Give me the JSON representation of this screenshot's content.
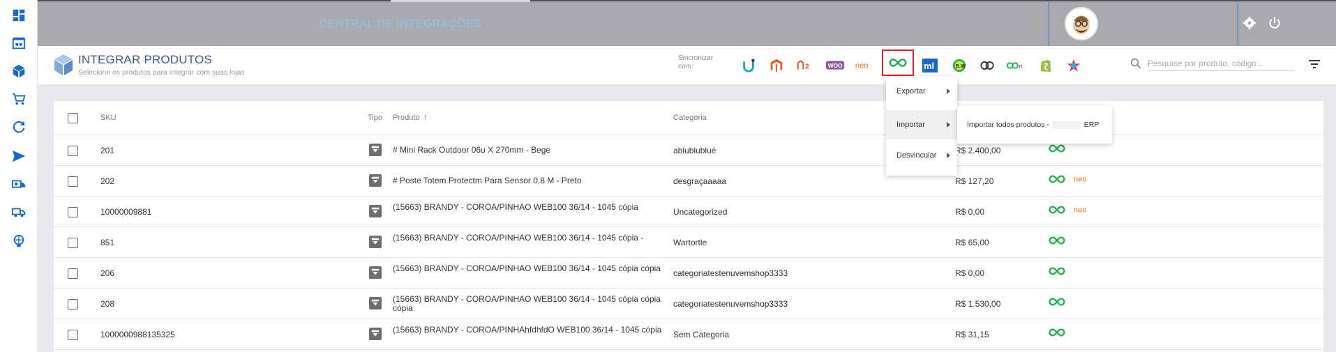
{
  "header": {
    "title": "CENTRAL DE INTEGRAÇÕES"
  },
  "page": {
    "title": "INTEGRAR PRODUTOS",
    "subtitle": "Selecione os produtos para integrar com suas lojas"
  },
  "sync": {
    "label": "Sincronizar com:",
    "integrations": [
      "uappi-icon",
      "magento-icon",
      "magento2-icon",
      "woocommerce-icon",
      "neo-icon",
      "infinity-icon",
      "mercadolivre-icon",
      "bw-icon",
      "link-icon",
      "oon-icon",
      "shopify-icon",
      "star-icon"
    ]
  },
  "search": {
    "placeholder": "Pesquise por produto, código..."
  },
  "table": {
    "headers": {
      "sku": "SKU",
      "tipo": "Tipo",
      "produto": "Produto",
      "produto_sort": "↑",
      "categoria": "Categoria"
    },
    "rows": [
      {
        "sku": "201",
        "produto": "# Mini Rack Outdoor 06u X 270mm - Bege",
        "categoria": "ablublublué",
        "preco": "R$ 2.400,00",
        "neo": false
      },
      {
        "sku": "202",
        "produto": "# Poste Totem Protectm Para Sensor 0,8 M - Preto",
        "categoria": "desgraçaaaaa",
        "preco": "R$ 127,20",
        "neo": true
      },
      {
        "sku": "10000009881",
        "produto": "(15663) BRANDY - COROA/PINHAO WEB100 36/14 - 1045 cópia",
        "categoria": "Uncategorized",
        "preco": "R$ 0,00",
        "neo": true
      },
      {
        "sku": "851",
        "produto": "(15663) BRANDY - COROA/PINHAO WEB100 36/14 - 1045 cópia -",
        "categoria": "Wartortle",
        "preco": "R$ 65,00",
        "neo": false
      },
      {
        "sku": "206",
        "produto": "(15663) BRANDY - COROA/PINHAO WEB100 36/14 - 1045 cópia cópia",
        "categoria": "categoriatestenuvemshop3333",
        "preco": "R$ 0,00",
        "neo": false
      },
      {
        "sku": "208",
        "produto": "(15663) BRANDY - COROA/PINHAO WEB100 36/14 - 1045 cópia cópia cópia",
        "categoria": "categoriatestenuvemshop3333",
        "preco": "R$ 1.530,00",
        "neo": false
      },
      {
        "sku": "1000000988135325",
        "produto": "(15663) BRANDY - COROA/PINHAhfdhfdO WEB100 36/14 - 1045 cópia",
        "categoria": "Sem Categoria",
        "preco": "R$ 31,15",
        "neo": false
      }
    ]
  },
  "menu": {
    "items": [
      "Exportar",
      "Importar",
      "Desvincular"
    ],
    "submenu_prefix": "Importar todos produtos -",
    "submenu_suffix": "ERP"
  },
  "colors": {
    "infinity": "#1fae4b",
    "neo": "#e8731f",
    "accent": "#3d5a8a",
    "sidebar_icon": "#1a66c9"
  }
}
